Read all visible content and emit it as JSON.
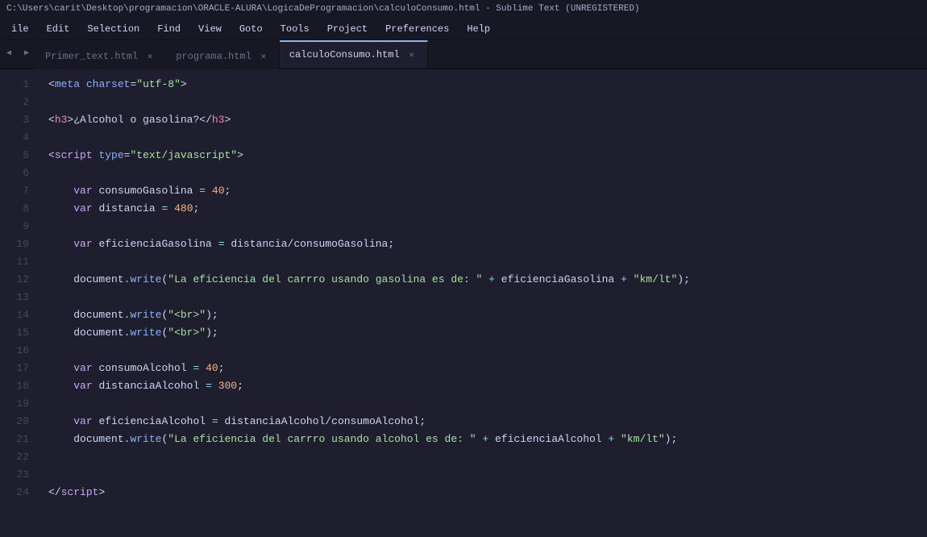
{
  "titlebar": {
    "text": "C:\\Users\\carit\\Desktop\\programacion\\ORACLE-ALURA\\LogicaDeProgramacion\\calculoConsumo.html - Sublime Text (UNREGISTERED)"
  },
  "menubar": {
    "items": [
      "ile",
      "Edit",
      "Selection",
      "Find",
      "View",
      "Goto",
      "Tools",
      "Project",
      "Preferences",
      "Help"
    ]
  },
  "tabs": [
    {
      "id": "tab1",
      "label": "Primer_text.html",
      "active": false
    },
    {
      "id": "tab2",
      "label": "programa.html",
      "active": false
    },
    {
      "id": "tab3",
      "label": "calculoConsumo.html",
      "active": true
    }
  ],
  "lines": {
    "numbers": [
      1,
      2,
      3,
      4,
      5,
      6,
      7,
      8,
      9,
      10,
      11,
      12,
      13,
      14,
      15,
      16,
      17,
      18,
      19,
      20,
      21,
      22,
      23,
      24
    ]
  }
}
